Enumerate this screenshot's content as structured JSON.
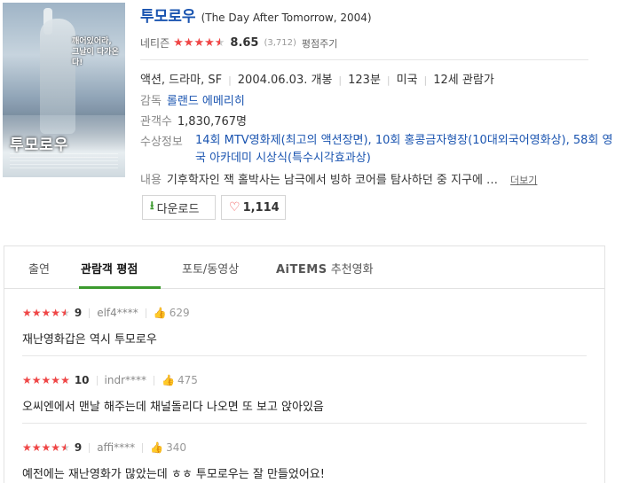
{
  "movie": {
    "title": "투모로우",
    "original": "(The Day After Tomorrow, 2004)",
    "poster": {
      "tagline": "깨어있어라, 그날이 다가온다!",
      "title": "투모로우"
    },
    "netizen_label": "네티즌",
    "netizen_rating": 8.65,
    "netizen_stars": 4.5,
    "score": "8.65",
    "rating_count": "(3,712)",
    "rate_link": "평점주기",
    "genre": "액션, 드라마, SF",
    "release": "2004.06.03. 개봉",
    "runtime": "123분",
    "country": "미국",
    "age": "12세 관람가",
    "director_label": "감독",
    "director": "롤랜드 에메리히",
    "audience_label": "관객수",
    "audience": "1,830,767명",
    "awards_label": "수상정보",
    "awards": "14회 MTV영화제(최고의 액션장면), 10회 홍콩금자형장(10대외국어영화상), 58회 영국 아카데미 시상식(특수시각효과상)",
    "synopsis_label": "내용",
    "synopsis": "기후학자인 잭 홀박사는 남극에서 빙하 코어를 탐사하던 중 지구에 …",
    "more_link": "더보기",
    "download_label": "다운로드",
    "like_count": "1,114"
  },
  "tabs": [
    {
      "label": "출연"
    },
    {
      "label": "관람객 평점"
    },
    {
      "label": "포토/동영상"
    },
    {
      "brand": "AiTEMS",
      "label": "추천영화"
    }
  ],
  "reviews": [
    {
      "stars": 4.5,
      "score": "9",
      "user": "elf4****",
      "likes": "629",
      "text": "재난영화갑은 역시 투모로우"
    },
    {
      "stars": 5,
      "score": "10",
      "user": "indr****",
      "likes": "475",
      "text": "오씨엔에서 맨날 해주는데 채널돌리다 나오면 또 보고 앉아있음"
    },
    {
      "stars": 4.5,
      "score": "9",
      "user": "affi****",
      "likes": "340",
      "text": "예전에는 재난영화가 많았는데 ㅎㅎ 투모로우는 잘 만들었어요!"
    }
  ],
  "colors": {
    "star": "#ef4646",
    "link": "#1a54b0",
    "active_tab": "#3c9a2e"
  },
  "icons": {
    "download": "download-arrow-icon",
    "like": "heart-icon",
    "review_like": "thumb-up-icon"
  }
}
